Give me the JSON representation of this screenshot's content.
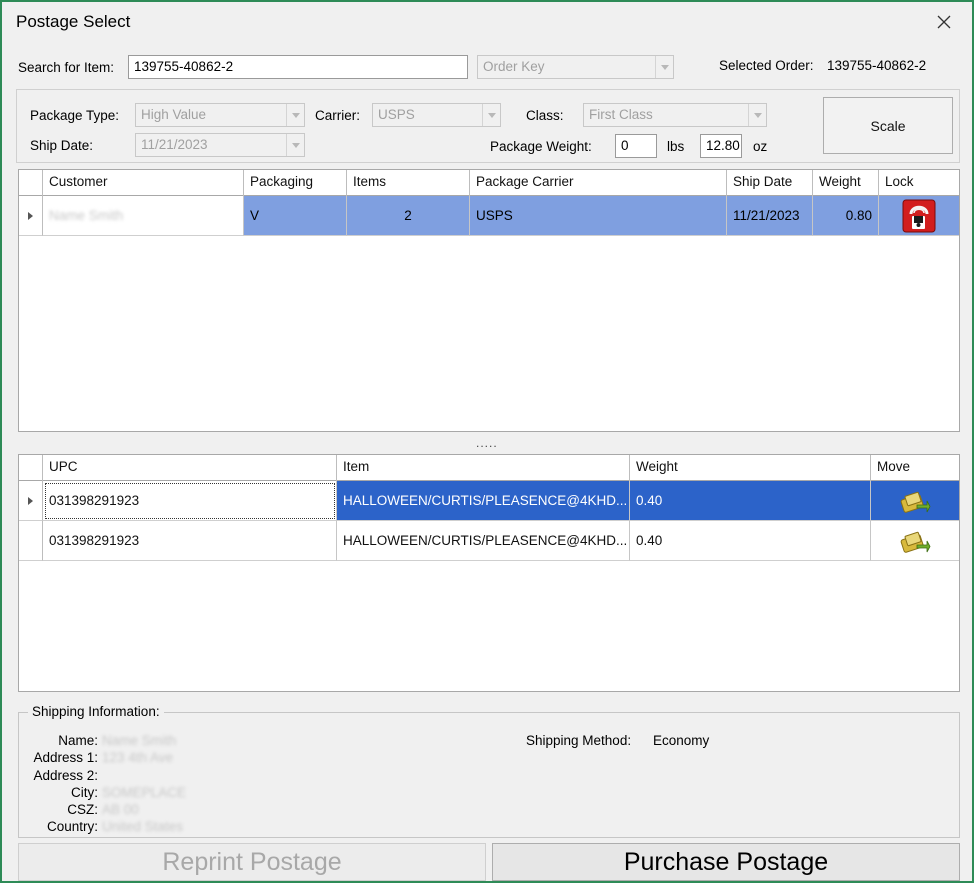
{
  "window": {
    "title": "Postage Select"
  },
  "search": {
    "label": "Search for Item:",
    "value": "139755-40862-2",
    "key_combo": "Order Key",
    "selected_order_label": "Selected Order:",
    "selected_order_value": "139755-40862-2"
  },
  "package": {
    "type_label": "Package Type:",
    "type_value": "High Value",
    "carrier_label": "Carrier:",
    "carrier_value": "USPS",
    "class_label": "Class:",
    "class_value": "First Class",
    "ship_date_label": "Ship Date:",
    "ship_date_value": "11/21/2023",
    "weight_label": "Package Weight:",
    "lbs_value": "0",
    "lbs_unit": "lbs",
    "oz_value": "12.80",
    "oz_unit": "oz",
    "scale_label": "Scale"
  },
  "orders": {
    "headers": [
      "Customer",
      "Packaging",
      "Items",
      "Package Carrier",
      "Ship Date",
      "Weight",
      "Lock"
    ],
    "rows": [
      {
        "customer": "Name Smith",
        "packaging": "V",
        "items": "2",
        "carrier": "USPS",
        "ship_date": "11/21/2023",
        "weight": "0.80",
        "lock_icon": "lock-icon"
      }
    ]
  },
  "splitter": ".....",
  "items": {
    "headers": [
      "UPC",
      "Item",
      "Weight",
      "Move"
    ],
    "rows": [
      {
        "upc": "031398291923",
        "item": "HALLOWEEN/CURTIS/PLEASENCE@4KHD...",
        "weight": "0.40",
        "move_icon": "move-icon"
      },
      {
        "upc": "031398291923",
        "item": "HALLOWEEN/CURTIS/PLEASENCE@4KHD...",
        "weight": "0.40",
        "move_icon": "move-icon"
      }
    ]
  },
  "shipping": {
    "group_label": "Shipping Information:",
    "name_label": "Name:",
    "name_value": "Name Smith",
    "address1_label": "Address 1:",
    "address1_value": "123 4th Ave",
    "address2_label": "Address 2:",
    "address2_value": "",
    "city_label": "City:",
    "city_value": "SOMEPLACE",
    "csz_label": "CSZ:",
    "csz_value": "AB 00",
    "country_label": "Country:",
    "country_value": "United States",
    "method_label": "Shipping Method:",
    "method_value": "Economy"
  },
  "actions": {
    "reprint_label": "Reprint Postage",
    "purchase_label": "Purchase Postage"
  },
  "colors": {
    "window_border": "#2e8b57",
    "row_selected_light": "#7f9fe0",
    "row_selected_dark": "#2c63c9"
  }
}
